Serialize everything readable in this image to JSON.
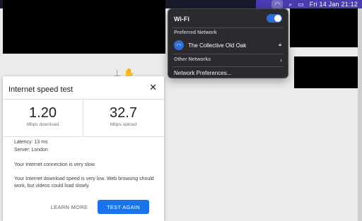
{
  "menubar": {
    "wifi_icon": "wifi-icon",
    "search_icon": "search-icon",
    "control_center_icon": "control-center-icon",
    "clock": "Fri 14 Jan  21:12"
  },
  "wifi_menu": {
    "title": "Wi-Fi",
    "enabled": true,
    "preferred_label": "Preferred Network",
    "network_name": "The Collective Old Oak",
    "other_label": "Other Networks",
    "prefs_label": "Network Preferences..."
  },
  "speedtest": {
    "title": "Internet speed test",
    "download_value": "1.20",
    "download_unit": "Mbps download",
    "upload_value": "32.7",
    "upload_unit": "Mbps upload",
    "latency": "Latency: 13 ms",
    "server": "Server: London",
    "status": "Your Internet connection is very slow.",
    "details": "Your Internet download speed is very low. Web browsing should work, but videos could load slowly.",
    "learn_more": "LEARN MORE",
    "test_again": "TEST AGAIN"
  },
  "colors": {
    "accent": "#1a73e8",
    "menubar": "#4a3bb0",
    "wifi_toggle": "#2e6ed8"
  }
}
